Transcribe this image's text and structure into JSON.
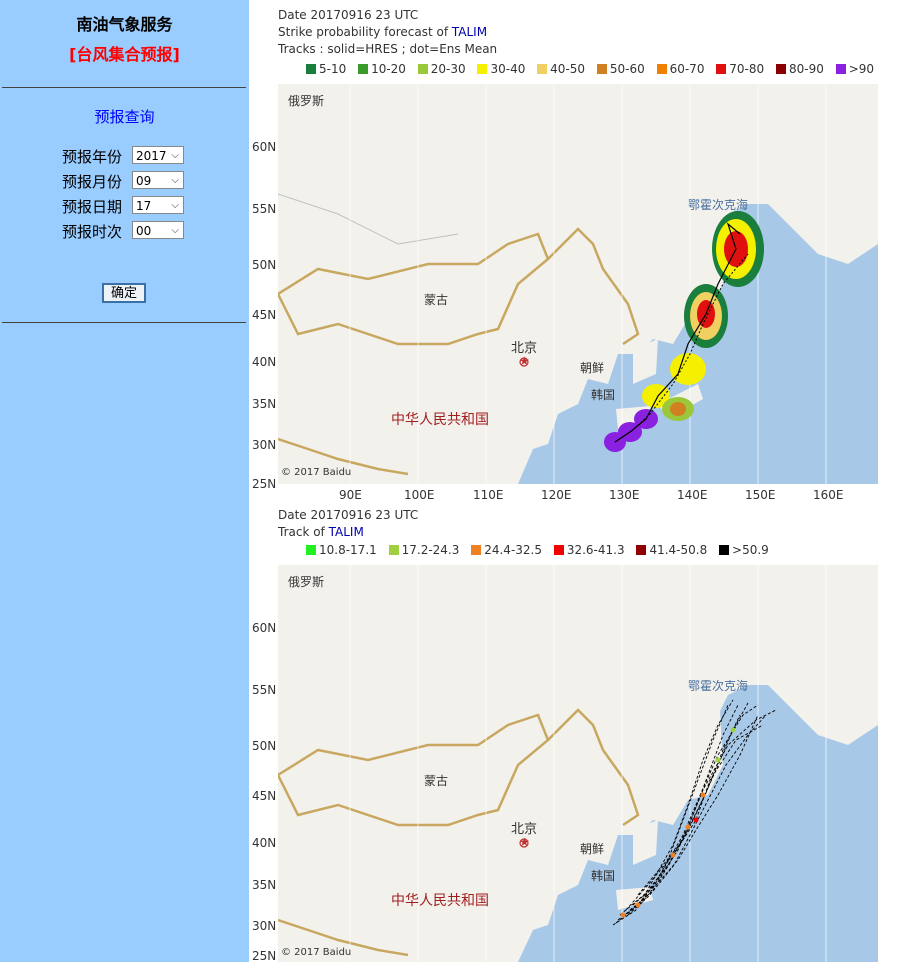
{
  "sidebar": {
    "title": "南油气象服务",
    "subtitle": "[台风集合预报]",
    "query_heading": "预报查询",
    "fields": [
      {
        "label": "预报年份",
        "value": "2017"
      },
      {
        "label": "预报月份",
        "value": "09"
      },
      {
        "label": "预报日期",
        "value": "17"
      },
      {
        "label": "预报时次",
        "value": "00"
      }
    ],
    "submit_label": "确定"
  },
  "panel1": {
    "line1": "Date 20170916 23 UTC",
    "line2_prefix": "Strike probability forecast of ",
    "storm_name": "TALIM",
    "line3": "Tracks : solid=HRES ; dot=Ens Mean",
    "legend": [
      {
        "label": "5-10",
        "color": "#1a7f3c"
      },
      {
        "label": "10-20",
        "color": "#3a9a2a"
      },
      {
        "label": "20-30",
        "color": "#9ac83a"
      },
      {
        "label": "30-40",
        "color": "#f5f000"
      },
      {
        "label": "40-50",
        "color": "#f0d060"
      },
      {
        "label": "50-60",
        "color": "#d08020"
      },
      {
        "label": "60-70",
        "color": "#f08000"
      },
      {
        "label": "70-80",
        "color": "#e01010"
      },
      {
        "label": "80-90",
        "color": "#8a0000"
      },
      {
        "label": ">90",
        "color": "#8a20e0"
      }
    ]
  },
  "panel2": {
    "line1": "Date 20170916 23 UTC",
    "line2_prefix": "Track of ",
    "storm_name": "TALIM",
    "legend": [
      {
        "label": "10.8-17.1",
        "color": "#20f020"
      },
      {
        "label": "17.2-24.3",
        "color": "#a0d040"
      },
      {
        "label": "24.4-32.5",
        "color": "#f08020"
      },
      {
        "label": "32.6-41.3",
        "color": "#f00000"
      },
      {
        "label": "41.4-50.8",
        "color": "#900000"
      },
      {
        "label": ">50.9",
        "color": "#000000"
      }
    ]
  },
  "map": {
    "lat_labels": [
      "60N",
      "55N",
      "50N",
      "45N",
      "40N",
      "35N",
      "30N",
      "25N"
    ],
    "lon_labels": [
      "90E",
      "100E",
      "110E",
      "120E",
      "130E",
      "140E",
      "150E",
      "160E"
    ],
    "place_russia": "俄罗斯",
    "place_mongolia": "蒙古",
    "place_beijing": "北京",
    "place_korea_n": "朝鲜",
    "place_korea_s": "韩国",
    "place_china": "中华人民共和国",
    "place_okhotsk": "鄂霍次克海",
    "copyright": "© 2017 Baidu"
  }
}
